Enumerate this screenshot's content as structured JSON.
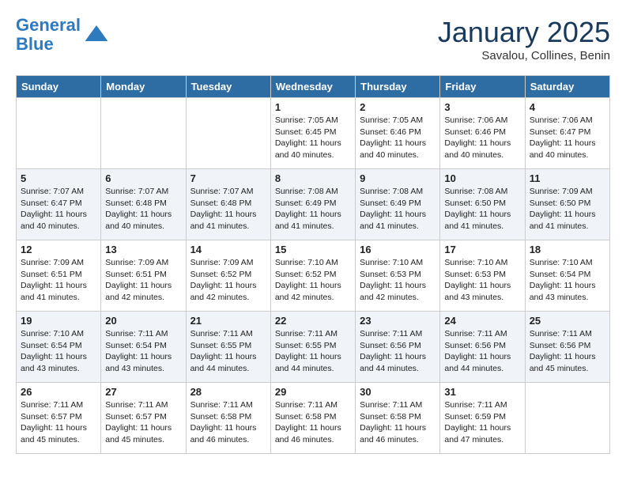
{
  "header": {
    "logo_line1": "General",
    "logo_line2": "Blue",
    "month": "January 2025",
    "location": "Savalou, Collines, Benin"
  },
  "weekdays": [
    "Sunday",
    "Monday",
    "Tuesday",
    "Wednesday",
    "Thursday",
    "Friday",
    "Saturday"
  ],
  "weeks": [
    [
      {
        "day": "",
        "info": ""
      },
      {
        "day": "",
        "info": ""
      },
      {
        "day": "",
        "info": ""
      },
      {
        "day": "1",
        "info": "Sunrise: 7:05 AM\nSunset: 6:45 PM\nDaylight: 11 hours\nand 40 minutes."
      },
      {
        "day": "2",
        "info": "Sunrise: 7:05 AM\nSunset: 6:46 PM\nDaylight: 11 hours\nand 40 minutes."
      },
      {
        "day": "3",
        "info": "Sunrise: 7:06 AM\nSunset: 6:46 PM\nDaylight: 11 hours\nand 40 minutes."
      },
      {
        "day": "4",
        "info": "Sunrise: 7:06 AM\nSunset: 6:47 PM\nDaylight: 11 hours\nand 40 minutes."
      }
    ],
    [
      {
        "day": "5",
        "info": "Sunrise: 7:07 AM\nSunset: 6:47 PM\nDaylight: 11 hours\nand 40 minutes."
      },
      {
        "day": "6",
        "info": "Sunrise: 7:07 AM\nSunset: 6:48 PM\nDaylight: 11 hours\nand 40 minutes."
      },
      {
        "day": "7",
        "info": "Sunrise: 7:07 AM\nSunset: 6:48 PM\nDaylight: 11 hours\nand 41 minutes."
      },
      {
        "day": "8",
        "info": "Sunrise: 7:08 AM\nSunset: 6:49 PM\nDaylight: 11 hours\nand 41 minutes."
      },
      {
        "day": "9",
        "info": "Sunrise: 7:08 AM\nSunset: 6:49 PM\nDaylight: 11 hours\nand 41 minutes."
      },
      {
        "day": "10",
        "info": "Sunrise: 7:08 AM\nSunset: 6:50 PM\nDaylight: 11 hours\nand 41 minutes."
      },
      {
        "day": "11",
        "info": "Sunrise: 7:09 AM\nSunset: 6:50 PM\nDaylight: 11 hours\nand 41 minutes."
      }
    ],
    [
      {
        "day": "12",
        "info": "Sunrise: 7:09 AM\nSunset: 6:51 PM\nDaylight: 11 hours\nand 41 minutes."
      },
      {
        "day": "13",
        "info": "Sunrise: 7:09 AM\nSunset: 6:51 PM\nDaylight: 11 hours\nand 42 minutes."
      },
      {
        "day": "14",
        "info": "Sunrise: 7:09 AM\nSunset: 6:52 PM\nDaylight: 11 hours\nand 42 minutes."
      },
      {
        "day": "15",
        "info": "Sunrise: 7:10 AM\nSunset: 6:52 PM\nDaylight: 11 hours\nand 42 minutes."
      },
      {
        "day": "16",
        "info": "Sunrise: 7:10 AM\nSunset: 6:53 PM\nDaylight: 11 hours\nand 42 minutes."
      },
      {
        "day": "17",
        "info": "Sunrise: 7:10 AM\nSunset: 6:53 PM\nDaylight: 11 hours\nand 43 minutes."
      },
      {
        "day": "18",
        "info": "Sunrise: 7:10 AM\nSunset: 6:54 PM\nDaylight: 11 hours\nand 43 minutes."
      }
    ],
    [
      {
        "day": "19",
        "info": "Sunrise: 7:10 AM\nSunset: 6:54 PM\nDaylight: 11 hours\nand 43 minutes."
      },
      {
        "day": "20",
        "info": "Sunrise: 7:11 AM\nSunset: 6:54 PM\nDaylight: 11 hours\nand 43 minutes."
      },
      {
        "day": "21",
        "info": "Sunrise: 7:11 AM\nSunset: 6:55 PM\nDaylight: 11 hours\nand 44 minutes."
      },
      {
        "day": "22",
        "info": "Sunrise: 7:11 AM\nSunset: 6:55 PM\nDaylight: 11 hours\nand 44 minutes."
      },
      {
        "day": "23",
        "info": "Sunrise: 7:11 AM\nSunset: 6:56 PM\nDaylight: 11 hours\nand 44 minutes."
      },
      {
        "day": "24",
        "info": "Sunrise: 7:11 AM\nSunset: 6:56 PM\nDaylight: 11 hours\nand 44 minutes."
      },
      {
        "day": "25",
        "info": "Sunrise: 7:11 AM\nSunset: 6:56 PM\nDaylight: 11 hours\nand 45 minutes."
      }
    ],
    [
      {
        "day": "26",
        "info": "Sunrise: 7:11 AM\nSunset: 6:57 PM\nDaylight: 11 hours\nand 45 minutes."
      },
      {
        "day": "27",
        "info": "Sunrise: 7:11 AM\nSunset: 6:57 PM\nDaylight: 11 hours\nand 45 minutes."
      },
      {
        "day": "28",
        "info": "Sunrise: 7:11 AM\nSunset: 6:58 PM\nDaylight: 11 hours\nand 46 minutes."
      },
      {
        "day": "29",
        "info": "Sunrise: 7:11 AM\nSunset: 6:58 PM\nDaylight: 11 hours\nand 46 minutes."
      },
      {
        "day": "30",
        "info": "Sunrise: 7:11 AM\nSunset: 6:58 PM\nDaylight: 11 hours\nand 46 minutes."
      },
      {
        "day": "31",
        "info": "Sunrise: 7:11 AM\nSunset: 6:59 PM\nDaylight: 11 hours\nand 47 minutes."
      },
      {
        "day": "",
        "info": ""
      }
    ]
  ]
}
